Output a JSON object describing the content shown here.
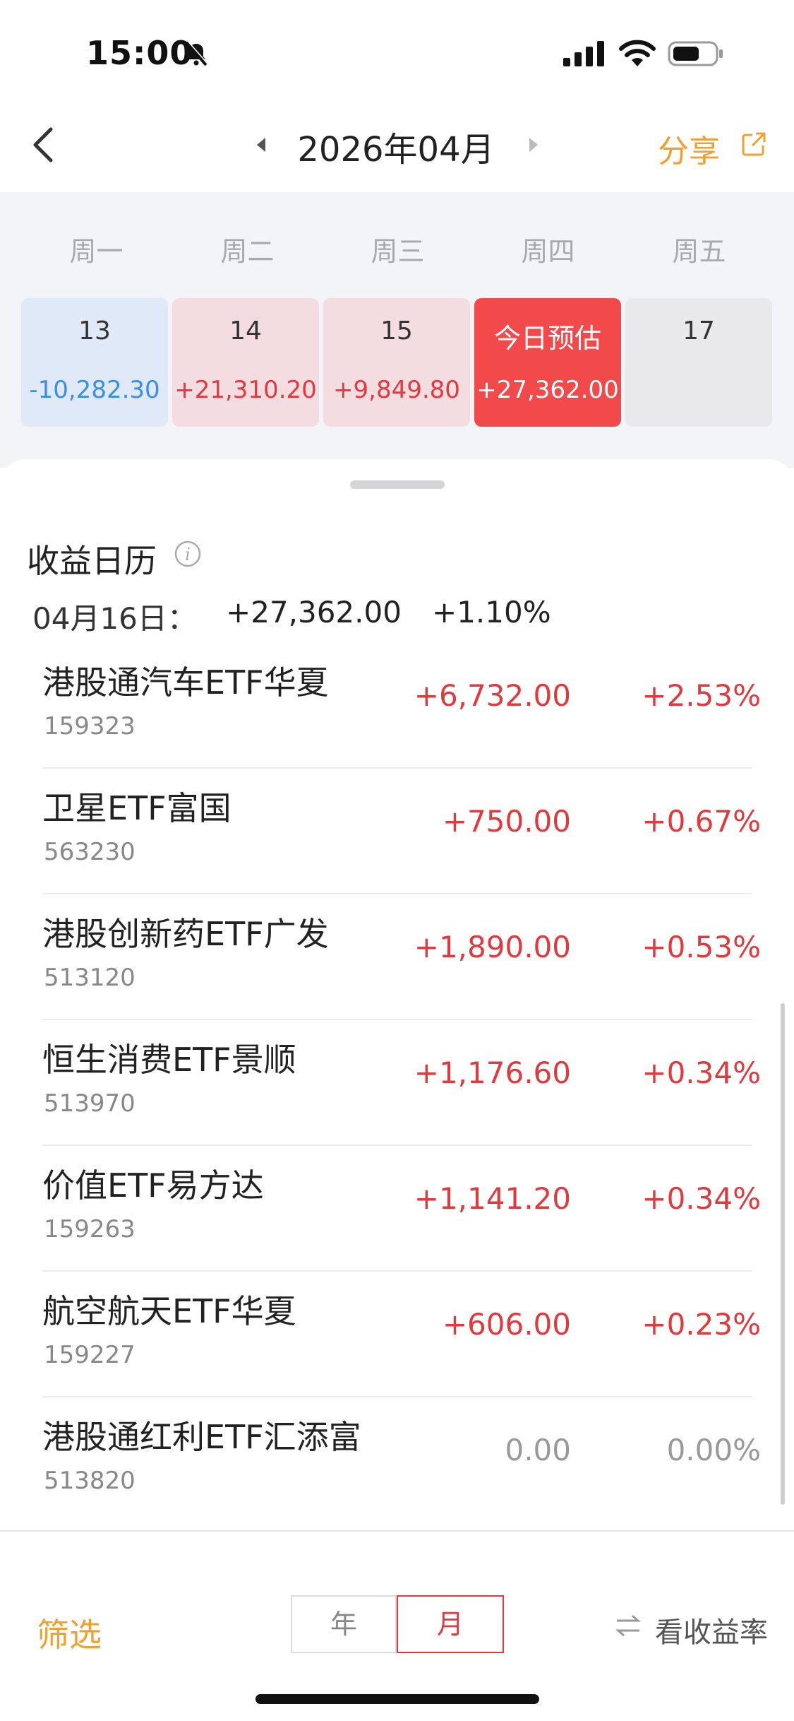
{
  "status_bar": {
    "time": "15:00"
  },
  "nav": {
    "month_title": "2026年04月",
    "share_label": "分享"
  },
  "calendar": {
    "weekdays": [
      "周一",
      "周二",
      "周三",
      "周四",
      "周五"
    ],
    "days": [
      {
        "label": "13",
        "value": "-10,282.30"
      },
      {
        "label": "14",
        "value": "+21,310.20"
      },
      {
        "label": "15",
        "value": "+9,849.80"
      },
      {
        "label": "今日预估",
        "value": "+27,362.00"
      },
      {
        "label": "17",
        "value": ""
      }
    ]
  },
  "summary": {
    "title": "收益日历",
    "date": "04月16日：",
    "amount": "+27,362.00",
    "percent": "+1.10%"
  },
  "holdings": [
    {
      "name": "港股通汽车ETF华夏",
      "code": "159323",
      "amount": "+6,732.00",
      "percent": "+2.53%"
    },
    {
      "name": "卫星ETF富国",
      "code": "563230",
      "amount": "+750.00",
      "percent": "+0.67%"
    },
    {
      "name": "港股创新药ETF广发",
      "code": "513120",
      "amount": "+1,890.00",
      "percent": "+0.53%"
    },
    {
      "name": "恒生消费ETF景顺",
      "code": "513970",
      "amount": "+1,176.60",
      "percent": "+0.34%"
    },
    {
      "name": "价值ETF易方达",
      "code": "159263",
      "amount": "+1,141.20",
      "percent": "+0.34%"
    },
    {
      "name": "航空航天ETF华夏",
      "code": "159227",
      "amount": "+606.00",
      "percent": "+0.23%"
    },
    {
      "name": "港股通红利ETF汇添富",
      "code": "513820",
      "amount": "0.00",
      "percent": "0.00%"
    }
  ],
  "bottom_bar": {
    "filter_label": "筛选",
    "year_label": "年",
    "month_label": "月",
    "view_rate_label": "看收益率"
  },
  "colors": {
    "accent_orange": "#f0a030",
    "gain_red": "#e0393e",
    "loss_blue": "#3a8ee6",
    "neutral_gray": "#999999"
  }
}
